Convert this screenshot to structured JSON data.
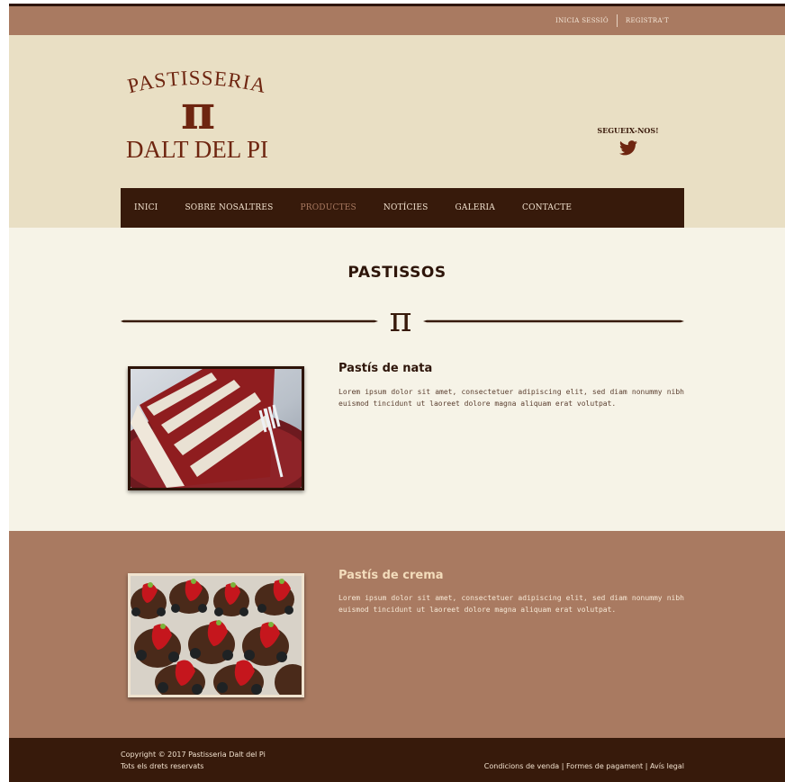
{
  "topbar": {
    "login_label": "INICIA SESSIÓ",
    "register_label": "REGISTRA'T"
  },
  "logo": {
    "line1": "PASTISSERIA",
    "symbol": "π",
    "line2": "DALT DEL PI"
  },
  "social": {
    "label": "SEGUEIX-NOS!",
    "icon": "twitter-bird-icon"
  },
  "nav": {
    "items": [
      {
        "label": "INICI"
      },
      {
        "label": "SOBRE NOSALTRES"
      },
      {
        "label": "PRODUCTES"
      },
      {
        "label": "NOTÍCIES"
      },
      {
        "label": "GALERIA"
      },
      {
        "label": "CONTACTE"
      }
    ],
    "active_index": 2
  },
  "main": {
    "title": "PASTISSOS",
    "divider_symbol": "π"
  },
  "products": [
    {
      "title": "Pastís de nata",
      "text": "Lorem ipsum dolor sit amet, consectetuer adipiscing elit, sed diam nonummy nibh euismod tincidunt ut laoreet dolore magna aliquam erat volutpat.",
      "image": "red-velvet-cake-slice-photo"
    },
    {
      "title": "Pastís de crema",
      "text": "Lorem ipsum dolor sit amet, consectetuer adipiscing elit, sed diam nonummy nibh euismod tincidunt ut laoreet dolore magna aliquam erat volutpat.",
      "image": "chocolate-strawberry-tartlets-photo"
    }
  ],
  "footer": {
    "copyright": "Copyright © 2017 Pastisseria Dalt del Pi",
    "rights": "Tots els drets reservats",
    "links": "Condicions de venda | Formes de pagament | Avís legal"
  },
  "colors": {
    "dark_brown": "#371a0b",
    "mid_brown": "#a97a61",
    "cream": "#e9dfc4",
    "light_cream": "#f6f3e7",
    "logo_red_brown": "#6e2510"
  }
}
